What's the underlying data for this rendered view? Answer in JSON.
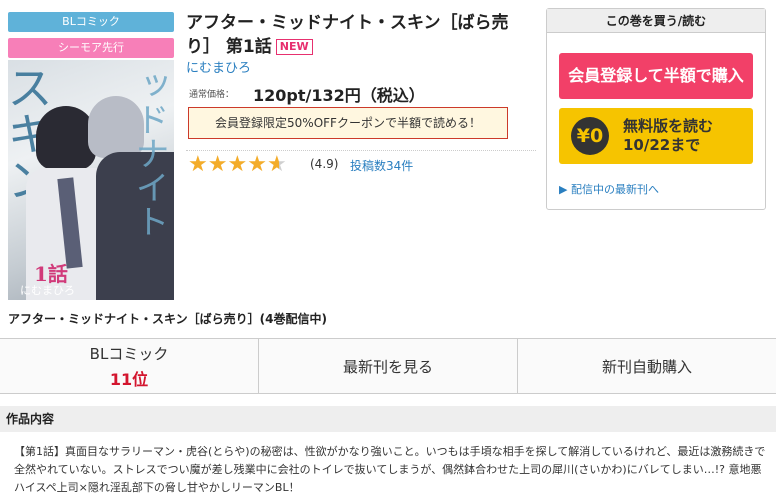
{
  "tags": {
    "category": "BLコミック",
    "campaign": "シーモア先行"
  },
  "cover": {
    "title_art": "アフター・ミッドナイト・スキン",
    "volume": "1話",
    "author": "にむまひろ"
  },
  "product": {
    "title": "アフター・ミッドナイト・スキン［ばら売り］ 第1話",
    "new_badge": "NEW",
    "author": "にむまひろ",
    "price_label": "通常価格：",
    "price": "120pt/132円（税込）",
    "coupon": "会員登録限定50%OFFクーポンで半額で読める！",
    "rating_value": 4.9,
    "rating_text": "(4.9)",
    "reviews": "投稿数34件"
  },
  "buybox": {
    "header": "この巻を買う/読む",
    "buy_button": "会員登録して半額で購入",
    "free_icon": "¥0",
    "free_line1": "無料版を読む",
    "free_line2": "10/22まで",
    "latest_link": "▶ 配信中の最新刊へ"
  },
  "series_title": "アフター・ミッドナイト・スキン［ばら売り］(4巻配信中)",
  "tabs": {
    "ranking_label": "BLコミック",
    "ranking_value": "11位",
    "latest": "最新刊を見る",
    "auto_buy": "新刊自動購入"
  },
  "summary": {
    "heading": "作品内容",
    "text": "【第1話】真面目なサラリーマン・虎谷(とらや)の秘密は、性欲がかなり強いこと。いつもは手頃な相手を探して解消しているけれど、最近は激務続きで全然やれていない。ストレスでつい魔が差し残業中に会社のトイレで抜いてしまうが、偶然鉢合わせた上司の犀川(さいかわ)にバレてしまい…!? 意地悪ハイスペ上司×隠れ淫乱部下の脅し甘やかしリーマンBL！"
  },
  "colors": {
    "accent_pink": "#f24068",
    "accent_yellow": "#f6c400",
    "link_blue": "#2a7fc0",
    "rank_red": "#d3152e"
  }
}
